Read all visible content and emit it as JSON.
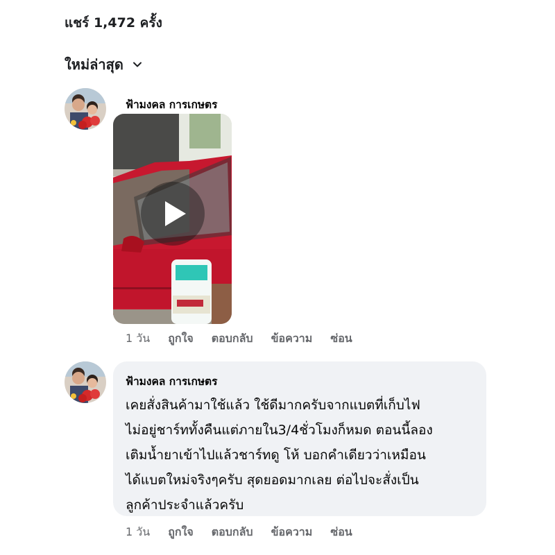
{
  "share_count": "แชร์ 1,472 ครั้ง",
  "sort": {
    "label": "ใหม่ล่าสุด",
    "icon": "chevron-down-icon"
  },
  "comments": [
    {
      "author": "ฟ้ามงคล การเกษตร",
      "media": "video",
      "time": "1 วัน",
      "actions": {
        "like": "ถูกใจ",
        "reply": "ตอบกลับ",
        "message": "ข้อความ",
        "hide": "ซ่อน"
      }
    },
    {
      "author": "ฟ้ามงคล การเกษตร",
      "text_lines": [
        "เคยสั่งสินค้ามาใช้แล้ว ใช้ดีมากครับจากแบตที่เก็บไฟ",
        "ไม่อยู่ชาร์ททั้งคืนแต่ภายใน3/4ชั่วโมงก็หมด ตอนนี้ลอง",
        "เติมน้ำยาเข้าไปแล้วชาร์ทดู โห้ บอกคำเดียวว่าเหมือน",
        "ได้แบตใหม่จริงๆครับ สุดยอดมากเลย ต่อไปจะสั่งเป็น",
        "ลูกค้าประจำแล้วครับ"
      ],
      "time": "1 วัน",
      "actions": {
        "like": "ถูกใจ",
        "reply": "ตอบกลับ",
        "message": "ข้อความ",
        "hide": "ซ่อน"
      }
    }
  ],
  "colors": {
    "text": "#050505",
    "meta": "#65676b",
    "bubble": "#f0f2f5"
  }
}
